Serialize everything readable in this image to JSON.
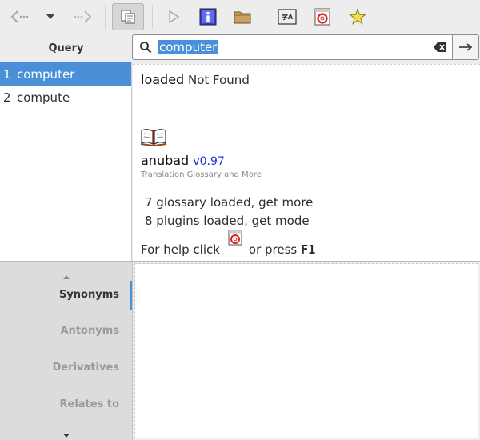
{
  "toolbar": {
    "buttons": [
      {
        "name": "back-button",
        "icon": "back-arrow-icon"
      },
      {
        "name": "history-dropdown-button",
        "icon": "chevron-down-icon"
      },
      {
        "name": "forward-button",
        "icon": "forward-arrow-icon"
      },
      {
        "name": "copy-button",
        "icon": "copy-icon"
      },
      {
        "name": "play-button",
        "icon": "play-icon"
      },
      {
        "name": "info-button",
        "icon": "info-icon"
      },
      {
        "name": "folder-button",
        "icon": "folder-icon"
      },
      {
        "name": "font-button",
        "icon": "font-icon"
      },
      {
        "name": "help-button",
        "icon": "lifebuoy-icon"
      },
      {
        "name": "favorite-button",
        "icon": "star-icon"
      }
    ]
  },
  "query": {
    "header": "Query",
    "items": [
      {
        "num": "1",
        "text": "computer",
        "selected": true
      },
      {
        "num": "2",
        "text": "compute",
        "selected": false
      }
    ]
  },
  "search": {
    "value": "computer"
  },
  "result": {
    "loaded_bold": "loaded",
    "loaded_rest": "Not Found",
    "brand_name": "anubad",
    "version": "v0.97",
    "tagline": "Translation Glossary and More",
    "stat1": "7 glossary loaded, get more",
    "stat2": "8 plugins loaded, get mode",
    "help_pre": "For help click",
    "help_mid": "or press",
    "help_key": "F1"
  },
  "tabs": {
    "items": [
      "Synonyms",
      "Antonyms",
      "Derivatives",
      "Relates to"
    ],
    "active": "Synonyms"
  },
  "colors": {
    "accent": "#4a90d9",
    "version": "#1a2fe0"
  }
}
